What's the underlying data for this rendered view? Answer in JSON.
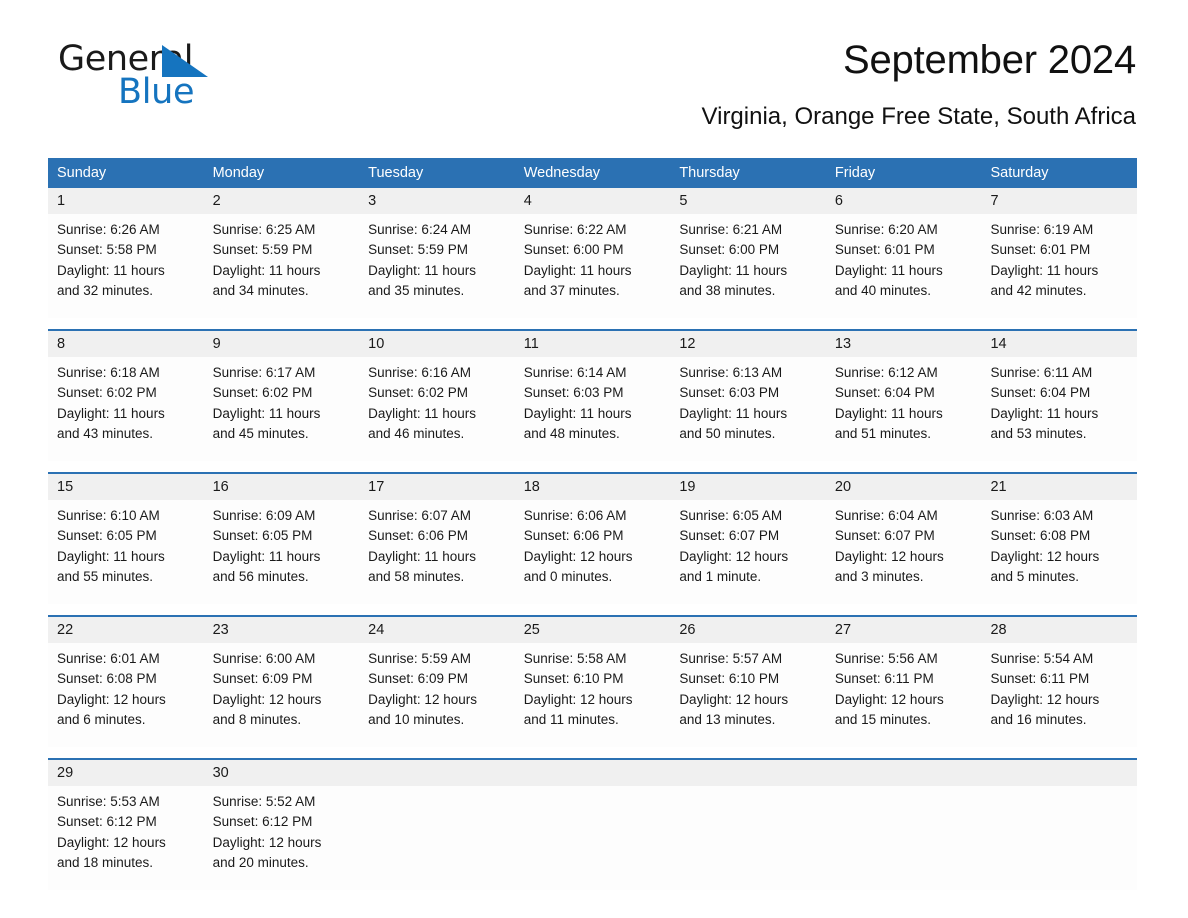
{
  "brand": {
    "name_top": "General",
    "name_bottom": "Blue",
    "accent_color": "#1574bf",
    "triangle_icon": "brand-triangle-icon"
  },
  "header": {
    "title": "September 2024",
    "subtitle": "Virginia, Orange Free State, South Africa"
  },
  "calendar": {
    "header_bg": "#2b71b3",
    "daynum_bg": "#f0f0f0",
    "weekdays": [
      "Sunday",
      "Monday",
      "Tuesday",
      "Wednesday",
      "Thursday",
      "Friday",
      "Saturday"
    ],
    "weeks": [
      {
        "days": [
          {
            "num": "1",
            "lines": [
              "Sunrise: 6:26 AM",
              "Sunset: 5:58 PM",
              "Daylight: 11 hours",
              "and 32 minutes."
            ]
          },
          {
            "num": "2",
            "lines": [
              "Sunrise: 6:25 AM",
              "Sunset: 5:59 PM",
              "Daylight: 11 hours",
              "and 34 minutes."
            ]
          },
          {
            "num": "3",
            "lines": [
              "Sunrise: 6:24 AM",
              "Sunset: 5:59 PM",
              "Daylight: 11 hours",
              "and 35 minutes."
            ]
          },
          {
            "num": "4",
            "lines": [
              "Sunrise: 6:22 AM",
              "Sunset: 6:00 PM",
              "Daylight: 11 hours",
              "and 37 minutes."
            ]
          },
          {
            "num": "5",
            "lines": [
              "Sunrise: 6:21 AM",
              "Sunset: 6:00 PM",
              "Daylight: 11 hours",
              "and 38 minutes."
            ]
          },
          {
            "num": "6",
            "lines": [
              "Sunrise: 6:20 AM",
              "Sunset: 6:01 PM",
              "Daylight: 11 hours",
              "and 40 minutes."
            ]
          },
          {
            "num": "7",
            "lines": [
              "Sunrise: 6:19 AM",
              "Sunset: 6:01 PM",
              "Daylight: 11 hours",
              "and 42 minutes."
            ]
          }
        ]
      },
      {
        "days": [
          {
            "num": "8",
            "lines": [
              "Sunrise: 6:18 AM",
              "Sunset: 6:02 PM",
              "Daylight: 11 hours",
              "and 43 minutes."
            ]
          },
          {
            "num": "9",
            "lines": [
              "Sunrise: 6:17 AM",
              "Sunset: 6:02 PM",
              "Daylight: 11 hours",
              "and 45 minutes."
            ]
          },
          {
            "num": "10",
            "lines": [
              "Sunrise: 6:16 AM",
              "Sunset: 6:02 PM",
              "Daylight: 11 hours",
              "and 46 minutes."
            ]
          },
          {
            "num": "11",
            "lines": [
              "Sunrise: 6:14 AM",
              "Sunset: 6:03 PM",
              "Daylight: 11 hours",
              "and 48 minutes."
            ]
          },
          {
            "num": "12",
            "lines": [
              "Sunrise: 6:13 AM",
              "Sunset: 6:03 PM",
              "Daylight: 11 hours",
              "and 50 minutes."
            ]
          },
          {
            "num": "13",
            "lines": [
              "Sunrise: 6:12 AM",
              "Sunset: 6:04 PM",
              "Daylight: 11 hours",
              "and 51 minutes."
            ]
          },
          {
            "num": "14",
            "lines": [
              "Sunrise: 6:11 AM",
              "Sunset: 6:04 PM",
              "Daylight: 11 hours",
              "and 53 minutes."
            ]
          }
        ]
      },
      {
        "days": [
          {
            "num": "15",
            "lines": [
              "Sunrise: 6:10 AM",
              "Sunset: 6:05 PM",
              "Daylight: 11 hours",
              "and 55 minutes."
            ]
          },
          {
            "num": "16",
            "lines": [
              "Sunrise: 6:09 AM",
              "Sunset: 6:05 PM",
              "Daylight: 11 hours",
              "and 56 minutes."
            ]
          },
          {
            "num": "17",
            "lines": [
              "Sunrise: 6:07 AM",
              "Sunset: 6:06 PM",
              "Daylight: 11 hours",
              "and 58 minutes."
            ]
          },
          {
            "num": "18",
            "lines": [
              "Sunrise: 6:06 AM",
              "Sunset: 6:06 PM",
              "Daylight: 12 hours",
              "and 0 minutes."
            ]
          },
          {
            "num": "19",
            "lines": [
              "Sunrise: 6:05 AM",
              "Sunset: 6:07 PM",
              "Daylight: 12 hours",
              "and 1 minute."
            ]
          },
          {
            "num": "20",
            "lines": [
              "Sunrise: 6:04 AM",
              "Sunset: 6:07 PM",
              "Daylight: 12 hours",
              "and 3 minutes."
            ]
          },
          {
            "num": "21",
            "lines": [
              "Sunrise: 6:03 AM",
              "Sunset: 6:08 PM",
              "Daylight: 12 hours",
              "and 5 minutes."
            ]
          }
        ]
      },
      {
        "days": [
          {
            "num": "22",
            "lines": [
              "Sunrise: 6:01 AM",
              "Sunset: 6:08 PM",
              "Daylight: 12 hours",
              "and 6 minutes."
            ]
          },
          {
            "num": "23",
            "lines": [
              "Sunrise: 6:00 AM",
              "Sunset: 6:09 PM",
              "Daylight: 12 hours",
              "and 8 minutes."
            ]
          },
          {
            "num": "24",
            "lines": [
              "Sunrise: 5:59 AM",
              "Sunset: 6:09 PM",
              "Daylight: 12 hours",
              "and 10 minutes."
            ]
          },
          {
            "num": "25",
            "lines": [
              "Sunrise: 5:58 AM",
              "Sunset: 6:10 PM",
              "Daylight: 12 hours",
              "and 11 minutes."
            ]
          },
          {
            "num": "26",
            "lines": [
              "Sunrise: 5:57 AM",
              "Sunset: 6:10 PM",
              "Daylight: 12 hours",
              "and 13 minutes."
            ]
          },
          {
            "num": "27",
            "lines": [
              "Sunrise: 5:56 AM",
              "Sunset: 6:11 PM",
              "Daylight: 12 hours",
              "and 15 minutes."
            ]
          },
          {
            "num": "28",
            "lines": [
              "Sunrise: 5:54 AM",
              "Sunset: 6:11 PM",
              "Daylight: 12 hours",
              "and 16 minutes."
            ]
          }
        ]
      },
      {
        "days": [
          {
            "num": "29",
            "lines": [
              "Sunrise: 5:53 AM",
              "Sunset: 6:12 PM",
              "Daylight: 12 hours",
              "and 18 minutes."
            ]
          },
          {
            "num": "30",
            "lines": [
              "Sunrise: 5:52 AM",
              "Sunset: 6:12 PM",
              "Daylight: 12 hours",
              "and 20 minutes."
            ]
          },
          {
            "num": "",
            "lines": []
          },
          {
            "num": "",
            "lines": []
          },
          {
            "num": "",
            "lines": []
          },
          {
            "num": "",
            "lines": []
          },
          {
            "num": "",
            "lines": []
          }
        ]
      }
    ]
  }
}
